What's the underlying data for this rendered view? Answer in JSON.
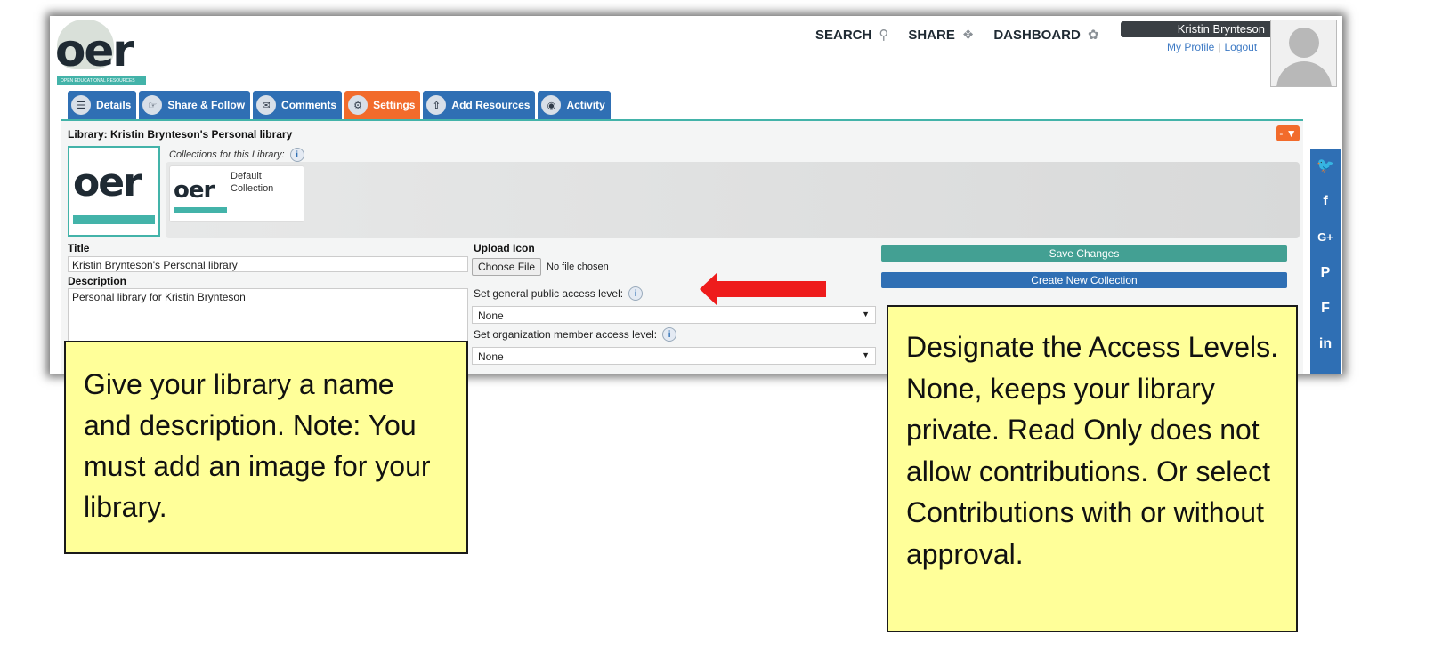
{
  "header": {
    "logo_text": "oer",
    "logo_tagline": "OPEN EDUCATIONAL RESOURCES",
    "nav": [
      {
        "label": "SEARCH",
        "icon": "search-icon"
      },
      {
        "label": "SHARE",
        "icon": "tag-icon"
      },
      {
        "label": "DASHBOARD",
        "icon": "dashboard-icon"
      }
    ],
    "user_name": "Kristin Brynteson",
    "my_profile": "My Profile",
    "logout": "Logout"
  },
  "tabs": [
    {
      "label": "Details",
      "icon": "books-icon",
      "active": false
    },
    {
      "label": "Share & Follow",
      "icon": "pointer-icon",
      "active": false
    },
    {
      "label": "Comments",
      "icon": "comments-icon",
      "active": false
    },
    {
      "label": "Settings",
      "icon": "settings-icon",
      "active": true
    },
    {
      "label": "Add Resources",
      "icon": "upload-icon",
      "active": false
    },
    {
      "label": "Activity",
      "icon": "mouse-icon",
      "active": false
    }
  ],
  "panel": {
    "library_heading": "Library: Kristin Brynteson's Personal library",
    "collapse_label": "- ▼",
    "collections_label": "Collections for this Library:",
    "collection_name": "Default Collection",
    "title_label": "Title",
    "title_value": "Kristin Brynteson's Personal library",
    "description_label": "Description",
    "description_value": "Personal library for Kristin Brynteson",
    "upload_label": "Upload Icon",
    "choose_file": "Choose File",
    "no_file": "No file chosen",
    "public_access_label": "Set general public access level:",
    "public_access_value": "None",
    "org_access_label": "Set organization member access level:",
    "org_access_value": "None",
    "save_label": "Save Changes",
    "create_label": "Create New Collection"
  },
  "social": [
    "twitter-icon",
    "facebook-icon",
    "google-plus-icon",
    "pinterest-icon",
    "flipboard-icon",
    "linkedin-icon"
  ],
  "social_glyphs": {
    "twitter": "🐦",
    "facebook": "f",
    "gplus": "G+",
    "pinterest": "P",
    "flipboard": "F",
    "linkedin": "in"
  },
  "callouts": {
    "left": "Give your library a name and description. Note: You must add an image for your library.",
    "right": "Designate the Access Levels. None, keeps your library private. Read Only does not allow contributions. Or select Contributions with or without approval."
  },
  "colors": {
    "teal": "#43b3a9",
    "blue": "#2f6fb4",
    "orange": "#f26b2b",
    "callout": "#ffff99",
    "arrow": "#ee1c1c"
  }
}
